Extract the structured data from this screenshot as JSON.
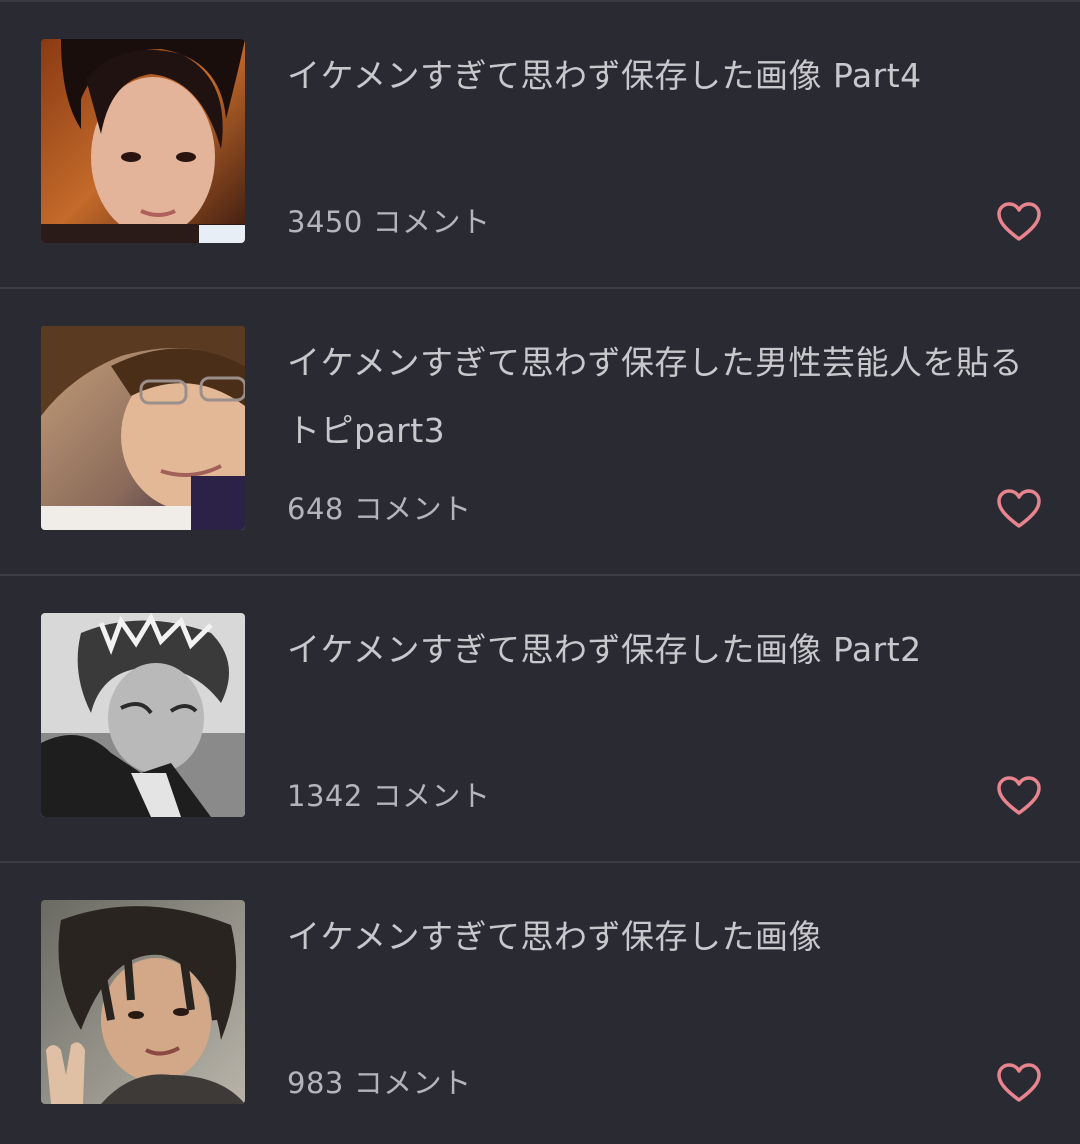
{
  "topics": [
    {
      "title": "イケメンすぎて思わず保存した画像 Part4",
      "comment_count": "3450",
      "comment_suffix": "コメント",
      "thumbnail_icon": "portrait-photo-warm"
    },
    {
      "title": "イケメンすぎて思わず保存した男性芸能人を貼るトピpart3",
      "comment_count": "648",
      "comment_suffix": "コメント",
      "thumbnail_icon": "portrait-photo-glasses"
    },
    {
      "title": "イケメンすぎて思わず保存した画像 Part2",
      "comment_count": "1342",
      "comment_suffix": "コメント",
      "thumbnail_icon": "portrait-photo-bw"
    },
    {
      "title": "イケメンすぎて思わず保存した画像",
      "comment_count": "983",
      "comment_suffix": "コメント",
      "thumbnail_icon": "portrait-photo-peace"
    }
  ],
  "colors": {
    "background": "#2a2a32",
    "heart": "#e8848e",
    "text": "#c8c8cc"
  }
}
